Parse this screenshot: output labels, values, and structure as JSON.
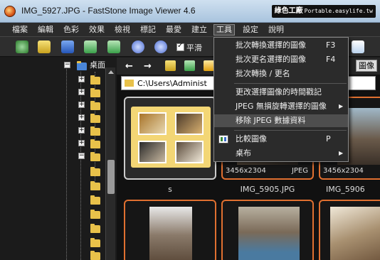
{
  "window": {
    "title": "IMG_5927.JPG  -  FastStone Image Viewer 4.6",
    "watermark_main": "綠色工廠",
    "watermark_sub": "Portable.easylife.tw"
  },
  "menubar": {
    "items": [
      "檔案",
      "編輯",
      "色彩",
      "效果",
      "檢視",
      "標記",
      "最愛",
      "建立",
      "工具",
      "設定",
      "說明"
    ],
    "active_index": 8
  },
  "toolbar": {
    "smooth_label": "平滑",
    "smooth_checked": true
  },
  "tree": {
    "desktop_label": "桌面"
  },
  "content": {
    "path": "C:\\Users\\Administ",
    "right_tab_label": "圖像"
  },
  "thumbnails": [
    {
      "caption": "s",
      "dims": "",
      "format": "",
      "selected": true
    },
    {
      "caption": "IMG_5905.JPG",
      "dims": "3456x2304",
      "format": "JPEG",
      "selected": false
    },
    {
      "caption": "IMG_5906",
      "dims": "3456x2304",
      "format": "",
      "selected": false
    }
  ],
  "tools_menu": {
    "items": [
      {
        "label": "批次轉換選擇的圖像",
        "shortcut": "F3"
      },
      {
        "label": "批次更名選擇的圖像",
        "shortcut": "F4"
      },
      {
        "label": "批次轉換 / 更名",
        "shortcut": ""
      },
      {
        "label": "更改選擇圖像的時間戳記",
        "shortcut": ""
      },
      {
        "label": "JPEG 無損旋轉選擇的圖像",
        "shortcut": ""
      },
      {
        "label": "移除 JPEG 數據資料",
        "shortcut": ""
      },
      {
        "label": "比較圖像",
        "shortcut": "P"
      },
      {
        "label": "桌布",
        "shortcut": ""
      }
    ],
    "highlighted_index": 5
  },
  "colors": {
    "accent_orange": "#e07030",
    "menu_bg": "#2b2b2b",
    "folder_yellow": "#e8c14a"
  }
}
